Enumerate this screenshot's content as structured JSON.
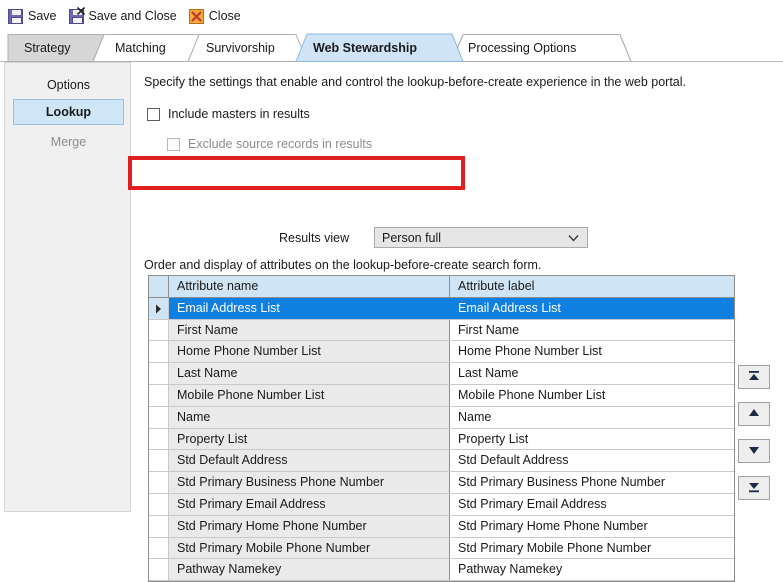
{
  "toolbar": {
    "items": [
      {
        "label": "Save",
        "icon": "save-icon"
      },
      {
        "label": "Save and Close",
        "icon": "save-and-close-icon"
      },
      {
        "label": "Close",
        "icon": "close-icon"
      }
    ]
  },
  "tabs": [
    {
      "label": "Strategy",
      "active": false
    },
    {
      "label": "Matching",
      "active": false
    },
    {
      "label": "Survivorship",
      "active": false
    },
    {
      "label": "Web Stewardship",
      "active": true
    },
    {
      "label": "Processing Options",
      "active": false
    }
  ],
  "sidebar": {
    "items": [
      {
        "label": "Options",
        "state": "normal"
      },
      {
        "label": "Lookup",
        "state": "selected"
      },
      {
        "label": "Merge",
        "state": "disabled"
      }
    ]
  },
  "main": {
    "description": "Specify the settings that enable and control the lookup-before-create experience in the web portal.",
    "checkboxes": [
      {
        "label": "Include masters in results",
        "checked": false,
        "disabled": false
      },
      {
        "label": "Exclude source records in results",
        "checked": false,
        "disabled": true
      }
    ],
    "results_view": {
      "label": "Results view",
      "value": "Person full",
      "chevron": "chevron-down-icon"
    },
    "grid_description": "Order and display of attributes on the lookup-before-create search form."
  },
  "grid": {
    "columns": [
      "Attribute name",
      "Attribute label"
    ],
    "rows": [
      {
        "name": "Email Address List",
        "label": "Email Address List",
        "selected": true
      },
      {
        "name": "First Name",
        "label": "First Name",
        "selected": false
      },
      {
        "name": "Home Phone Number List",
        "label": "Home Phone Number List",
        "selected": false
      },
      {
        "name": "Last Name",
        "label": "Last Name",
        "selected": false
      },
      {
        "name": "Mobile Phone Number List",
        "label": "Mobile Phone Number List",
        "selected": false
      },
      {
        "name": "Name",
        "label": "Name",
        "selected": false
      },
      {
        "name": "Property List",
        "label": "Property List",
        "selected": false
      },
      {
        "name": "Std Default Address",
        "label": "Std Default Address",
        "selected": false
      },
      {
        "name": "Std Primary Business Phone Number",
        "label": "Std Primary Business Phone Number",
        "selected": false
      },
      {
        "name": "Std Primary Email Address",
        "label": "Std Primary Email Address",
        "selected": false
      },
      {
        "name": "Std Primary Home Phone Number",
        "label": "Std Primary Home Phone Number",
        "selected": false
      },
      {
        "name": "Std Primary Mobile Phone Number",
        "label": "Std Primary Mobile Phone Number",
        "selected": false
      },
      {
        "name": "Pathway Namekey",
        "label": "Pathway Namekey",
        "selected": false
      }
    ]
  },
  "order_buttons": [
    {
      "name": "move-to-top-button",
      "icon": "move-to-top-icon"
    },
    {
      "name": "move-up-button",
      "icon": "move-up-icon"
    },
    {
      "name": "move-down-button",
      "icon": "move-down-icon"
    },
    {
      "name": "move-to-bottom-button",
      "icon": "move-to-bottom-icon"
    }
  ],
  "colors": {
    "selection_blue": "#0f7fe0",
    "header_blue": "#cfe4f5",
    "active_tab_blue": "#cfe4f7",
    "highlight_red": "#e02020",
    "panel_gray": "#f0f0f0"
  }
}
